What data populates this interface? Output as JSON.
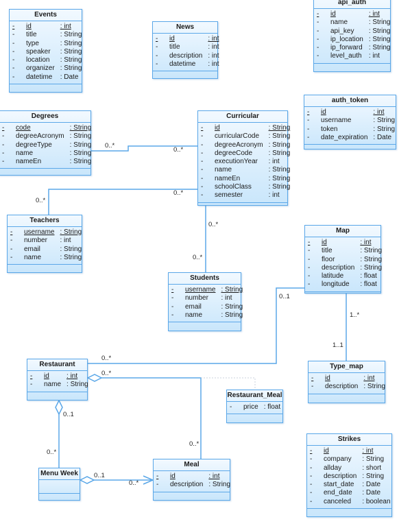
{
  "classes": [
    {
      "id": "events",
      "name": "Events",
      "attributes": [
        {
          "vis": "-",
          "name": "id",
          "type": ": int",
          "key": true
        },
        {
          "vis": "-",
          "name": "title",
          "type": ": String"
        },
        {
          "vis": "-",
          "name": "type",
          "type": ": String"
        },
        {
          "vis": "-",
          "name": "speaker",
          "type": ": String"
        },
        {
          "vis": "-",
          "name": "location",
          "type": ": String"
        },
        {
          "vis": "-",
          "name": "organizer",
          "type": ": String"
        },
        {
          "vis": "-",
          "name": "datetime",
          "type": ": Date"
        }
      ]
    },
    {
      "id": "news",
      "name": "News",
      "attributes": [
        {
          "vis": "-",
          "name": "id",
          "type": ": int",
          "key": true
        },
        {
          "vis": "-",
          "name": "title",
          "type": ": int"
        },
        {
          "vis": "-",
          "name": "description",
          "type": ": int"
        },
        {
          "vis": "-",
          "name": "datetime",
          "type": ": int"
        }
      ]
    },
    {
      "id": "api_auth",
      "name": "api_auth",
      "attributes": [
        {
          "vis": "-",
          "name": "id",
          "type": ": int",
          "key": true
        },
        {
          "vis": "-",
          "name": "name",
          "type": ": String"
        },
        {
          "vis": "-",
          "name": "api_key",
          "type": ": String"
        },
        {
          "vis": "-",
          "name": "ip_location",
          "type": ": String"
        },
        {
          "vis": "-",
          "name": "ip_forward",
          "type": ": String"
        },
        {
          "vis": "-",
          "name": "level_auth",
          "type": ": int"
        }
      ]
    },
    {
      "id": "auth_token",
      "name": "auth_token",
      "attributes": [
        {
          "vis": "-",
          "name": "id",
          "type": ": int",
          "key": true
        },
        {
          "vis": "-",
          "name": "username",
          "type": ": String"
        },
        {
          "vis": "-",
          "name": "token",
          "type": ": String"
        },
        {
          "vis": "-",
          "name": "date_expiration",
          "type": ": Date"
        }
      ]
    },
    {
      "id": "degrees",
      "name": "Degrees",
      "attributes": [
        {
          "vis": "-",
          "name": "code",
          "type": ": String",
          "key": true
        },
        {
          "vis": "-",
          "name": "degreeAcronym",
          "type": ": String"
        },
        {
          "vis": "-",
          "name": "degreeType",
          "type": ": String"
        },
        {
          "vis": "-",
          "name": "name",
          "type": ": String"
        },
        {
          "vis": "-",
          "name": "nameEn",
          "type": ": String"
        }
      ]
    },
    {
      "id": "curricular",
      "name": "Curricular",
      "attributes": [
        {
          "vis": "-",
          "name": "id",
          "type": ": String",
          "key": true
        },
        {
          "vis": "-",
          "name": "curricularCode",
          "type": ": String"
        },
        {
          "vis": "-",
          "name": "degreeAcronym",
          "type": ": String"
        },
        {
          "vis": "-",
          "name": "degreeCode",
          "type": ": String"
        },
        {
          "vis": "-",
          "name": "executionYear",
          "type": ": int"
        },
        {
          "vis": "-",
          "name": "name",
          "type": ": String"
        },
        {
          "vis": "-",
          "name": "nameEn",
          "type": ": String"
        },
        {
          "vis": "-",
          "name": "schoolClass",
          "type": ": String"
        },
        {
          "vis": "-",
          "name": "semester",
          "type": ": int"
        }
      ]
    },
    {
      "id": "teachers",
      "name": "Teachers",
      "attributes": [
        {
          "vis": "-",
          "name": "username",
          "type": ": String",
          "key": true
        },
        {
          "vis": "-",
          "name": "number",
          "type": ": int"
        },
        {
          "vis": "-",
          "name": "email",
          "type": ": String"
        },
        {
          "vis": "-",
          "name": "name",
          "type": ": String"
        }
      ]
    },
    {
      "id": "students",
      "name": "Students",
      "attributes": [
        {
          "vis": "-",
          "name": "username",
          "type": ": String",
          "key": true
        },
        {
          "vis": "-",
          "name": "number",
          "type": ": int"
        },
        {
          "vis": "-",
          "name": "email",
          "type": ": String"
        },
        {
          "vis": "-",
          "name": "name",
          "type": ": String"
        }
      ]
    },
    {
      "id": "map",
      "name": "Map",
      "attributes": [
        {
          "vis": "-",
          "name": "id",
          "type": ": int",
          "key": true
        },
        {
          "vis": "-",
          "name": "title",
          "type": ": String"
        },
        {
          "vis": "-",
          "name": "floor",
          "type": ": String"
        },
        {
          "vis": "-",
          "name": "description",
          "type": ": String"
        },
        {
          "vis": "-",
          "name": "latitude",
          "type": ": float"
        },
        {
          "vis": "-",
          "name": "longitude",
          "type": ": float"
        }
      ]
    },
    {
      "id": "type_map",
      "name": "Type_map",
      "attributes": [
        {
          "vis": "-",
          "name": "id",
          "type": ": int",
          "key": true
        },
        {
          "vis": "-",
          "name": "description",
          "type": ": String"
        }
      ]
    },
    {
      "id": "restaurant",
      "name": "Restaurant",
      "attributes": [
        {
          "vis": "-",
          "name": "id",
          "type": ": int",
          "key": true
        },
        {
          "vis": "-",
          "name": "name",
          "type": ": String"
        }
      ]
    },
    {
      "id": "restaurant_meal",
      "name": "Restaurant_Meal",
      "attributes": [
        {
          "vis": "-",
          "name": "price",
          "type": ": float"
        }
      ]
    },
    {
      "id": "menu_week",
      "name": "Menu Week",
      "attributes": []
    },
    {
      "id": "meal",
      "name": "Meal",
      "attributes": [
        {
          "vis": "-",
          "name": "id",
          "type": ": int",
          "key": true
        },
        {
          "vis": "-",
          "name": "description",
          "type": ": String"
        }
      ]
    },
    {
      "id": "strikes",
      "name": "Strikes",
      "attributes": [
        {
          "vis": "-",
          "name": "id",
          "type": ": int",
          "key": true
        },
        {
          "vis": "-",
          "name": "company",
          "type": ": String"
        },
        {
          "vis": "-",
          "name": "allday",
          "type": ": short"
        },
        {
          "vis": "-",
          "name": "description",
          "type": ": String"
        },
        {
          "vis": "-",
          "name": "start_date",
          "type": ": Date"
        },
        {
          "vis": "-",
          "name": "end_date",
          "type": ": Date"
        },
        {
          "vis": "-",
          "name": "canceled",
          "type": ": boolean"
        }
      ]
    }
  ],
  "associations": [
    {
      "id": "degrees-curricular",
      "from": "degrees",
      "to": "curricular",
      "kind": "association",
      "mult_from": "0..*",
      "mult_to": "0..*"
    },
    {
      "id": "curricular-teachers",
      "from": "curricular",
      "to": "teachers",
      "kind": "association",
      "mult_from": "0..*",
      "mult_to": "0..*"
    },
    {
      "id": "curricular-students",
      "from": "curricular",
      "to": "students",
      "kind": "association",
      "mult_from": "0..*",
      "mult_to": "0..*"
    },
    {
      "id": "map-type_map",
      "from": "map",
      "to": "type_map",
      "kind": "association",
      "mult_from": "1..*",
      "mult_to": "1..1"
    },
    {
      "id": "map-restaurant",
      "from": "map",
      "to": "restaurant",
      "kind": "association",
      "mult_from": "0..1",
      "mult_to": "0..*"
    },
    {
      "id": "restaurant-meal",
      "from": "restaurant",
      "to": "meal",
      "kind": "aggregation",
      "mult_from": "0..*",
      "mult_to": "0..*",
      "association_class": "restaurant_meal"
    },
    {
      "id": "restaurant-menu_week",
      "from": "restaurant",
      "to": "menu_week",
      "kind": "aggregation",
      "mult_from": "0..1",
      "mult_to": "0..*"
    },
    {
      "id": "menu_week-meal",
      "from": "menu_week",
      "to": "meal",
      "kind": "directed-aggregation",
      "mult_from": "0..1",
      "mult_to": "0..*"
    }
  ],
  "colors": {
    "line": "#5aa7e8",
    "box_top": "#f2f9ff",
    "box_bottom": "#c9e6fb",
    "association_class_link": "#c8d2dc"
  }
}
